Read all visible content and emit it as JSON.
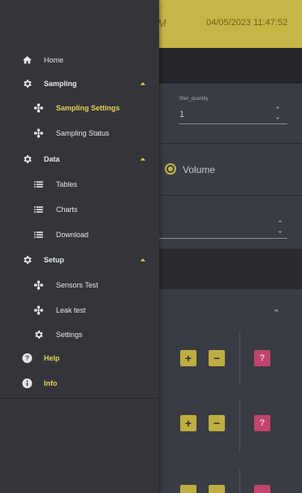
{
  "app_bar": {
    "brand_tail": "M",
    "datetime": "04/05/2023 11:47:52"
  },
  "colors": {
    "accent": "#e8d34a",
    "app_bar": "#c9b545",
    "drawer_bg": "#33353b",
    "danger": "#c2446e"
  },
  "form": {
    "filter_quantity_label": "filter_quantity",
    "filter_quantity_value": "1",
    "radio_label": "Volume"
  },
  "controls": {
    "plus": "+",
    "minus": "−",
    "question": "?",
    "caret_up": "⌃"
  },
  "nav": {
    "home": {
      "label": "Home",
      "icon": "home-icon"
    },
    "sampling": {
      "label": "Sampling",
      "icon": "gear-icon",
      "expanded": true
    },
    "sampling_settings": {
      "label": "Sampling Settings",
      "icon": "molecule-icon",
      "active": true
    },
    "sampling_status": {
      "label": "Sampling Status",
      "icon": "molecule-icon"
    },
    "data": {
      "label": "Data",
      "icon": "gear-icon",
      "expanded": true
    },
    "tables": {
      "label": "Tables",
      "icon": "list-icon"
    },
    "charts": {
      "label": "Charts",
      "icon": "list-icon"
    },
    "download": {
      "label": "Download",
      "icon": "list-icon"
    },
    "setup": {
      "label": "Setup",
      "icon": "gear-icon",
      "expanded": true
    },
    "sensors_test": {
      "label": "Sensors Test",
      "icon": "molecule-icon"
    },
    "leak_test": {
      "label": "Leak test",
      "icon": "molecule-icon"
    },
    "settings": {
      "label": "Settings",
      "icon": "gear-icon"
    },
    "help": {
      "label": "Help",
      "icon": "help-icon"
    },
    "info": {
      "label": "Info",
      "icon": "info-icon"
    }
  }
}
